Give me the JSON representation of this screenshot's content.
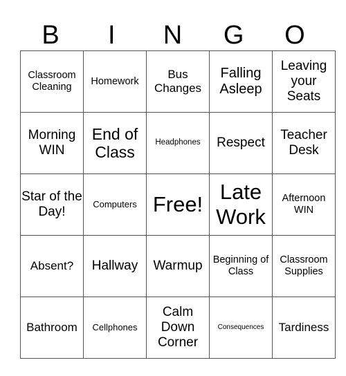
{
  "header": [
    "B",
    "I",
    "N",
    "G",
    "O"
  ],
  "cells": [
    [
      "Classroom Cleaning",
      "Homework",
      "Bus Changes",
      "Falling Asleep",
      "Leaving your Seats"
    ],
    [
      "Morning WIN",
      "End of Class",
      "Headphones",
      "Respect",
      "Teacher Desk"
    ],
    [
      "Star of the Day!",
      "Computers",
      "Free!",
      "Late Work",
      "Afternoon WIN"
    ],
    [
      "Absent?",
      "Hallway",
      "Warmup",
      "Beginning of Class",
      "Classroom Supplies"
    ],
    [
      "Bathroom",
      "Cellphones",
      "Calm Down Corner",
      "Consequences",
      "Tardiness"
    ]
  ]
}
